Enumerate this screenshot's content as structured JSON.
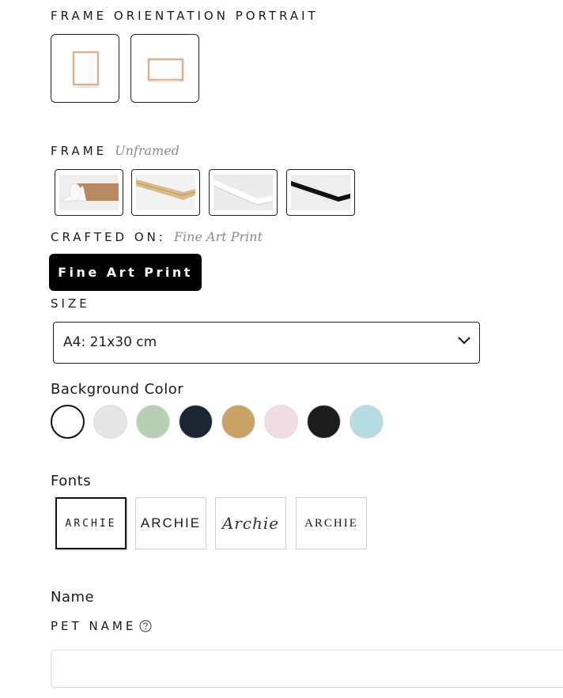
{
  "orientation": {
    "label": "FRAME ORIENTATION",
    "value": "PORTRAIT",
    "options": [
      {
        "name": "portrait"
      },
      {
        "name": "landscape"
      }
    ]
  },
  "frame": {
    "label": "FRAME",
    "value": "Unframed",
    "options": [
      {
        "name": "unframed"
      },
      {
        "name": "oak"
      },
      {
        "name": "white"
      },
      {
        "name": "black"
      }
    ]
  },
  "crafted_on": {
    "label": "CRAFTED ON:",
    "value": "Fine Art Print",
    "button_label": "Fine Art Print"
  },
  "size": {
    "label": "SIZE",
    "selected": "A4: 21x30 cm"
  },
  "background_color": {
    "label": "Background Color",
    "swatches": [
      {
        "color": "#ffffff",
        "selected": true
      },
      {
        "color": "#e6e6e6"
      },
      {
        "color": "#b8cfb6"
      },
      {
        "color": "#1d2733"
      },
      {
        "color": "#c9a466"
      },
      {
        "color": "#f1dde3"
      },
      {
        "color": "#1c1c1c"
      },
      {
        "color": "#b6dbe0"
      }
    ]
  },
  "fonts": {
    "label": "Fonts",
    "options": [
      {
        "sample": "ARCHIE",
        "selected": true
      },
      {
        "sample": "ARCHIE"
      },
      {
        "sample": "Archie"
      },
      {
        "sample": "ARCHIE"
      }
    ]
  },
  "name_section": {
    "heading": "Name",
    "pet_name_label": "PET NAME",
    "help_icon": "question-circle-icon",
    "input_value": ""
  }
}
